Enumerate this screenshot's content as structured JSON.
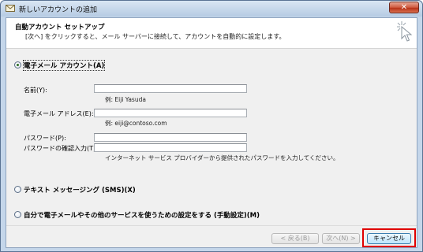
{
  "window": {
    "title": "新しいアカウントの追加",
    "close_label": "✕"
  },
  "header": {
    "title": "自動アカウント セットアップ",
    "description": "[次へ] をクリックすると、メール サーバーに接続して、アカウントを自動的に設定します。"
  },
  "options": {
    "email_account": "電子メール アカウント(A)",
    "sms": "テキスト メッセージング (SMS)(X)",
    "manual": "自分で電子メールやその他のサービスを使うための設定をする (手動設定)(M)"
  },
  "form": {
    "name_label": "名前(Y):",
    "name_value": "",
    "name_hint": "例: Eiji Yasuda",
    "email_label": "電子メール アドレス(E):",
    "email_value": "",
    "email_hint": "例: eiji@contoso.com",
    "password_label": "パスワード(P):",
    "password_value": "",
    "password_confirm_label": "パスワードの確認入力(T):",
    "password_confirm_value": "",
    "password_hint": "インターネット サービス プロバイダーから提供されたパスワードを入力してください。"
  },
  "buttons": {
    "back": "< 戻る(B)",
    "next": "次へ(N) >",
    "cancel": "キャンセル"
  },
  "colors": {
    "highlight": "#e00000",
    "close_button": "#c8462b"
  }
}
